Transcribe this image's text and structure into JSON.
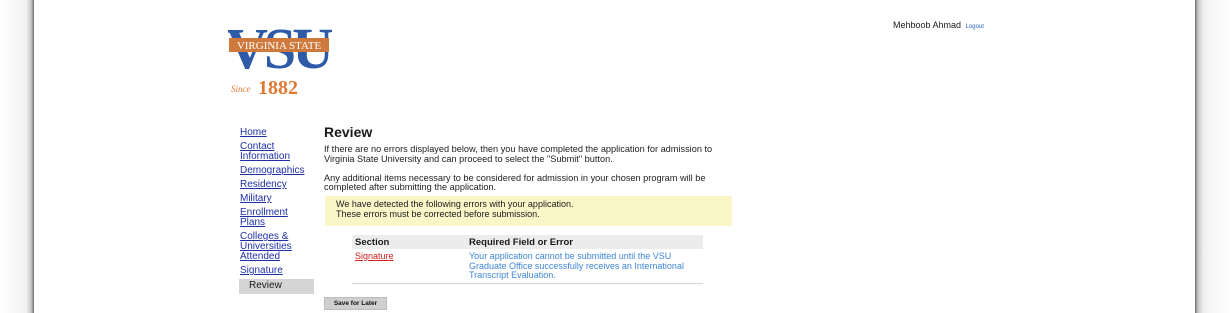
{
  "brand": {
    "logo_letters": "VSU",
    "banner_text": "VIRGINIA STATE",
    "since_word": "Since",
    "since_year": "1882",
    "colors": {
      "blue": "#2e5aa8",
      "orange": "#e07a33",
      "banner": "#cf7a3c"
    }
  },
  "user": {
    "name": "Mehboob Ahmad",
    "logout_label": "Logout"
  },
  "nav": {
    "items": [
      {
        "label": "Home"
      },
      {
        "label": "Contact Information"
      },
      {
        "label": "Demographics"
      },
      {
        "label": "Residency"
      },
      {
        "label": "Military"
      },
      {
        "label": "Enrollment Plans"
      },
      {
        "label": "Colleges & Universities Attended"
      },
      {
        "label": "Signature"
      },
      {
        "label": "Review"
      }
    ],
    "active": "Review"
  },
  "review": {
    "title": "Review",
    "para1": "If there are no errors displayed below, then you have completed the application for admission to Virginia State University and can proceed to select the \"Submit\" button.",
    "para2": "Any additional items necessary to be considered for admission in your chosen program will be completed after submitting the application.",
    "warning_line1": "We have detected the following errors with your application.",
    "warning_line2": "These errors must be corrected before submission.",
    "table": {
      "headers": [
        "Section",
        "Required Field or Error"
      ],
      "rows": [
        {
          "section": "Signature",
          "error": "Your application cannot be submitted until the VSU Graduate Office successfully receives an International Transcript Evaluation."
        }
      ]
    },
    "save_label": "Save for Later"
  }
}
